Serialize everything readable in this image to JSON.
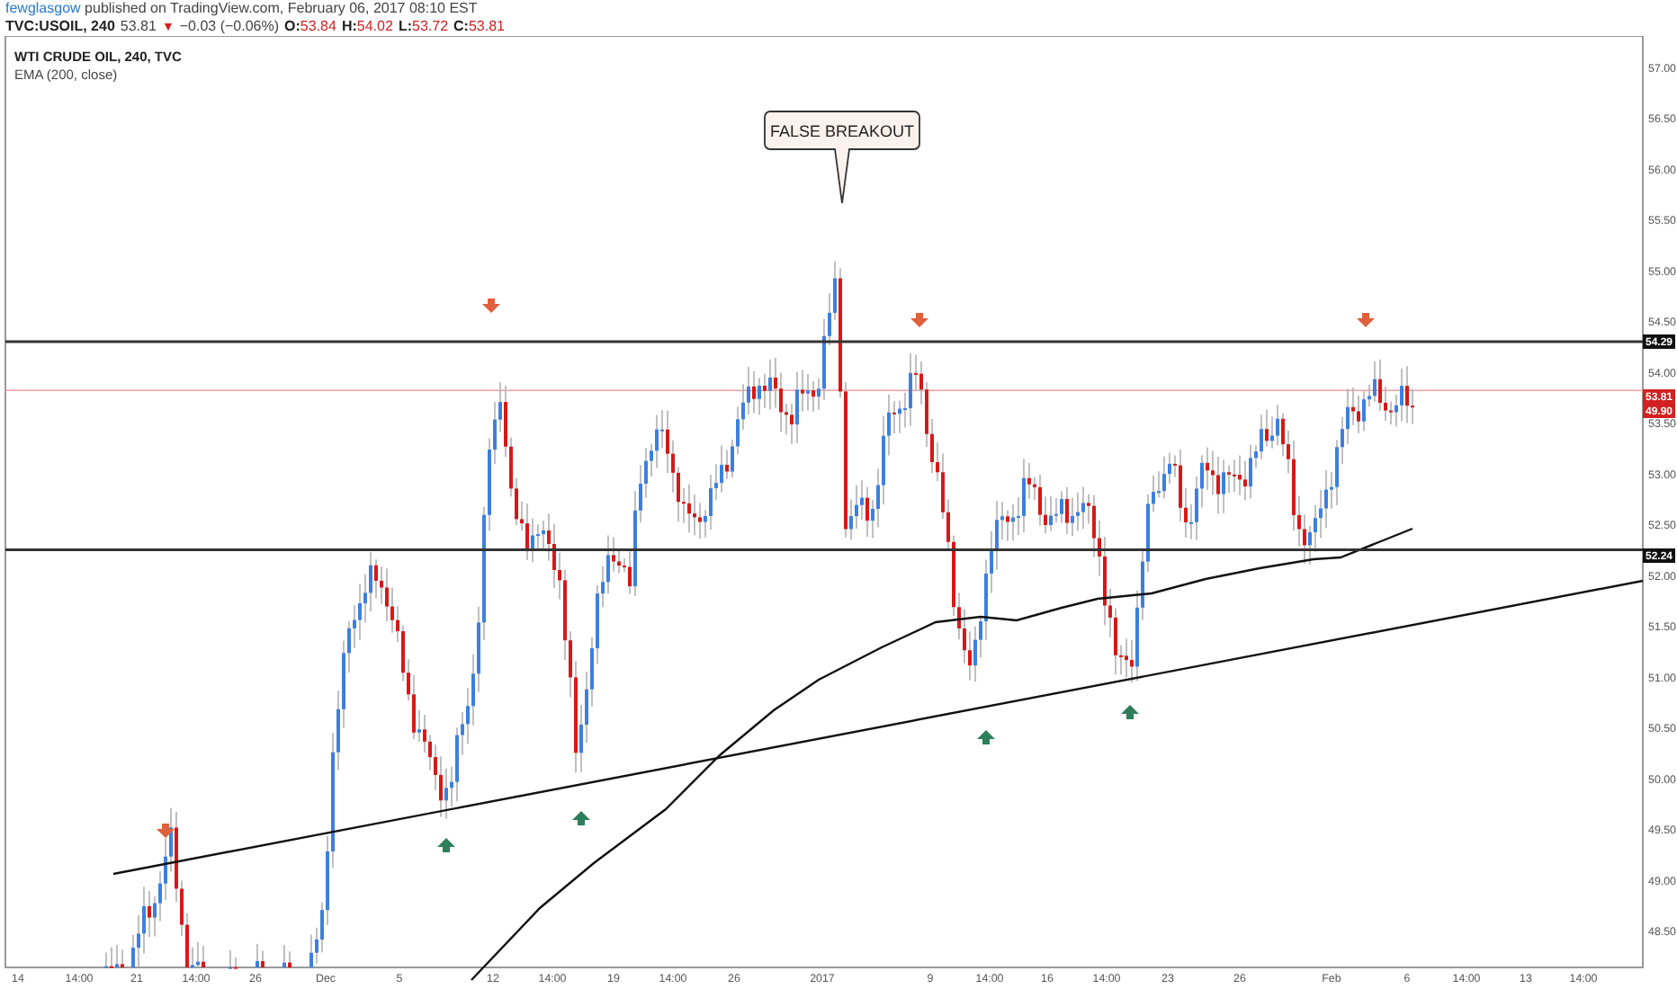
{
  "publish_line": {
    "author": "fewglasgow",
    "text": "published on TradingView.com, February 06, 2017 08:10 EST"
  },
  "quote": {
    "symbol": "TVC:USOIL, 240",
    "last": "53.81",
    "arrow": "▼",
    "change": "−0.03 (−0.06%)",
    "ohlc": [
      {
        "label": "O:",
        "value": "53.84"
      },
      {
        "label": "H:",
        "value": "54.02"
      },
      {
        "label": "L:",
        "value": "53.72"
      },
      {
        "label": "C:",
        "value": "53.81"
      }
    ]
  },
  "legend": {
    "title": "WTI CRUDE OIL, 240, TVC",
    "indicator": "EMA (200, close)"
  },
  "callout": {
    "text": "FALSE BREAKOUT"
  },
  "price_axis": {
    "labels": [
      "57.00",
      "56.50",
      "56.00",
      "55.50",
      "55.00",
      "54.50",
      "54.00",
      "53.50",
      "53.00",
      "52.50",
      "52.00",
      "51.50",
      "51.00",
      "50.50",
      "50.00",
      "49.50",
      "49.00",
      "48.50"
    ]
  },
  "price_tags": [
    {
      "text": "54.29",
      "color": "#111111"
    },
    {
      "text": "53.81",
      "color": "#d32020"
    },
    {
      "text": "49.90",
      "color": "#d32020"
    },
    {
      "text": "52.24",
      "color": "#111111"
    }
  ],
  "time_axis": {
    "labels": [
      "14",
      "14:00",
      "21",
      "14:00",
      "26",
      "Dec",
      "5",
      "12",
      "14:00",
      "19",
      "14:00",
      "26",
      "2017",
      "9",
      "14:00",
      "16",
      "14:00",
      "23",
      "26",
      "Feb",
      "6",
      "14:00",
      "13",
      "14:00"
    ]
  }
}
